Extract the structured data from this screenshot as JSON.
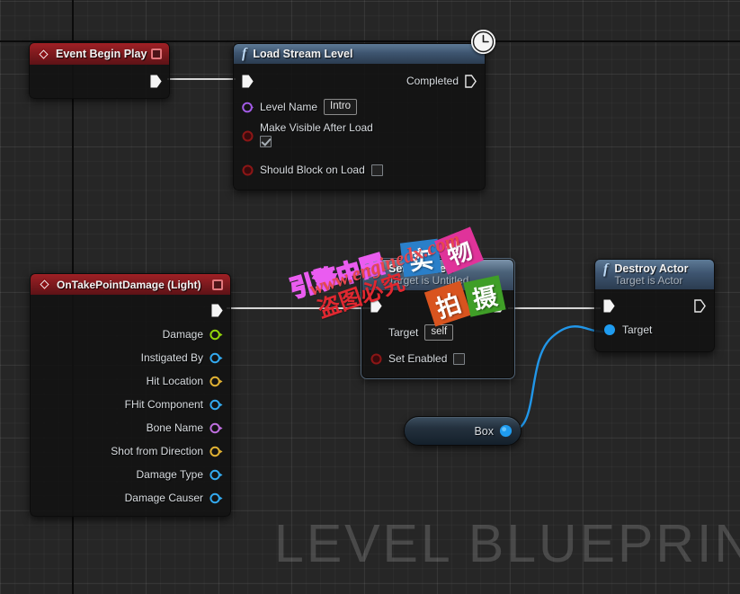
{
  "editor": {
    "graph_watermark": "LEVEL BLUEPRINT",
    "background_color": "#262626",
    "grid_minor_color": "#2e2e2e",
    "grid_major_color": "#343434"
  },
  "nodes": {
    "event_begin_play": {
      "title": "Event Begin Play",
      "icon": "event-diamond-icon",
      "header_color": "#7e1a1e",
      "breakpoint_visible": true,
      "output_exec_label": ""
    },
    "load_stream_level": {
      "title": "Load Stream Level",
      "icon": "function-f-icon",
      "header_color": "#3e5570",
      "latent_icon": "clock-icon",
      "input_exec_label": "",
      "output_exec_label": "Completed",
      "inputs": [
        {
          "label": "Level Name",
          "pin_type": "name",
          "pin_color": "#a45ce8",
          "value": "Intro",
          "control": "text"
        },
        {
          "label": "Make Visible After Load",
          "pin_type": "boolean",
          "pin_color": "#8c1616",
          "value": true,
          "control": "checkbox"
        },
        {
          "label": "Should Block on Load",
          "pin_type": "boolean",
          "pin_color": "#8c1616",
          "value": false,
          "control": "checkbox"
        }
      ]
    },
    "on_take_point_damage": {
      "title": "OnTakePointDamage (Light)",
      "icon": "event-diamond-icon",
      "header_color": "#7e1a1e",
      "breakpoint_visible": true,
      "outputs": [
        {
          "label": "Damage",
          "pin_type": "float",
          "pin_color": "#94d60a"
        },
        {
          "label": "Instigated By",
          "pin_type": "object",
          "pin_color": "#33aaf0"
        },
        {
          "label": "Hit Location",
          "pin_type": "vector",
          "pin_color": "#e2b233"
        },
        {
          "label": "FHit Component",
          "pin_type": "object",
          "pin_color": "#33aaf0"
        },
        {
          "label": "Bone Name",
          "pin_type": "name",
          "pin_color": "#c06fe0"
        },
        {
          "label": "Shot from Direction",
          "pin_type": "vector",
          "pin_color": "#e2b233"
        },
        {
          "label": "Damage Type",
          "pin_type": "object",
          "pin_color": "#33aaf0"
        },
        {
          "label": "Damage Causer",
          "pin_type": "object",
          "pin_color": "#33aaf0"
        }
      ]
    },
    "set_enabled": {
      "title": "Set Enabled",
      "subtitle": "Target is Untitled",
      "icon": "event-diamond-icon",
      "header_color": "#3d5268",
      "inputs": [
        {
          "label": "Target",
          "pin_type": "object",
          "pin_color": "#33aaf0",
          "value": "self",
          "control": "text"
        },
        {
          "label": "Set Enabled",
          "pin_type": "boolean",
          "pin_color": "#8c1616",
          "value": false,
          "control": "checkbox"
        }
      ]
    },
    "destroy_actor": {
      "title": "Destroy Actor",
      "subtitle": "Target is Actor",
      "icon": "function-f-icon",
      "header_color": "#3e5570",
      "inputs": [
        {
          "label": "Target",
          "pin_type": "object",
          "pin_color": "#1f9cf0"
        }
      ]
    },
    "box_variable": {
      "title": "Box",
      "pin_type": "object",
      "pin_color": "#1f9cf0"
    }
  },
  "wires": [
    {
      "from": "event_begin_play.exec_out",
      "to": "load_stream_level.exec_in",
      "color": "#d6d6d6",
      "type": "exec"
    },
    {
      "from": "on_take_point_damage.exec_out",
      "to": "set_enabled.exec_in",
      "color": "#d6d6d6",
      "type": "exec"
    },
    {
      "from": "set_enabled.exec_out",
      "to": "destroy_actor.exec_in",
      "color": "#d6d6d6",
      "type": "exec"
    },
    {
      "from": "box_variable.out",
      "to": "destroy_actor.target",
      "color": "#2196e8",
      "type": "data"
    }
  ],
  "overlay_watermark": {
    "outline_text": "引擎中国",
    "outline_color": "#ea5cf0",
    "url_text": "www.enginedx.com",
    "url_color": "#e8484f",
    "red_cn_text": "盗图必究",
    "red_cn_color": "#e02830",
    "tiles": [
      {
        "char": "实",
        "color": "#2a7fc9"
      },
      {
        "char": "物",
        "color": "#e0339a"
      },
      {
        "char": "拍",
        "color": "#d9541f"
      },
      {
        "char": "摄",
        "color": "#3f9e27"
      }
    ]
  }
}
